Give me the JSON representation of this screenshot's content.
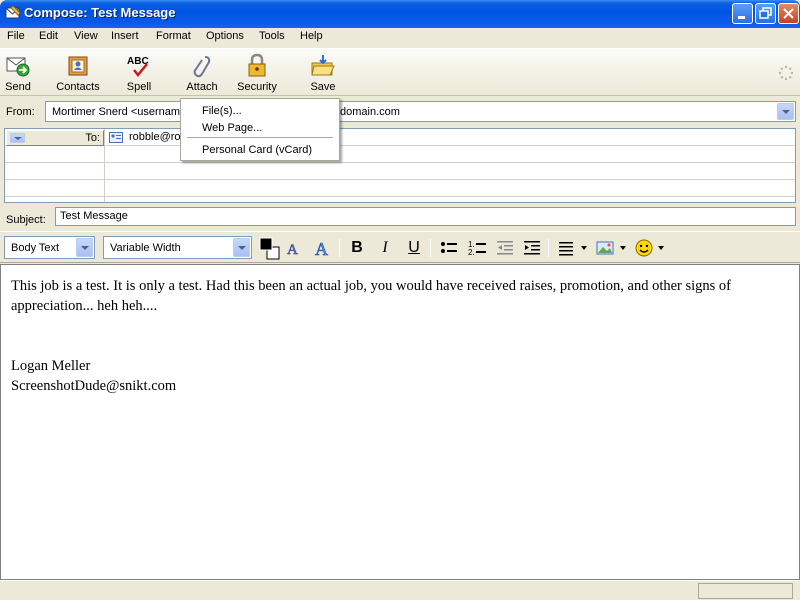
{
  "window": {
    "title": "Compose: Test Message"
  },
  "menu": [
    "File",
    "Edit",
    "View",
    "Insert",
    "Format",
    "Options",
    "Tools",
    "Help"
  ],
  "toolbar": {
    "send": "Send",
    "contacts": "Contacts",
    "spell": "Spell",
    "attach": "Attach",
    "security": "Security",
    "save": "Save"
  },
  "attach_menu": {
    "files": "File(s)...",
    "web_page": "Web Page...",
    "vcard": "Personal Card (vCard)"
  },
  "address": {
    "from_label": "From:",
    "from_value_left": "Mortimer Snerd <username",
    "from_value_right": "domain.com",
    "to_label": "To:",
    "to_value": "robble@ro",
    "subject_label": "Subject:",
    "subject_value": "Test Message"
  },
  "format": {
    "paragraph_style": "Body Text",
    "font": "Variable Width",
    "bold": "B",
    "italic": "I",
    "underline": "U"
  },
  "body": {
    "line1": "This job is a test.  It is only a test.  Had this been an actual job, you would have received raises, promotion, and other signs of",
    "line2": "appreciation... heh heh....",
    "line3": "Logan Meller",
    "line4": "ScreenshotDude@snikt.com"
  },
  "colors": {
    "titlebar": "#0054e3",
    "chrome": "#ece9d8"
  },
  "icons": [
    "send-icon",
    "contacts-icon",
    "spell-icon",
    "attach-icon",
    "security-icon",
    "save-icon"
  ]
}
